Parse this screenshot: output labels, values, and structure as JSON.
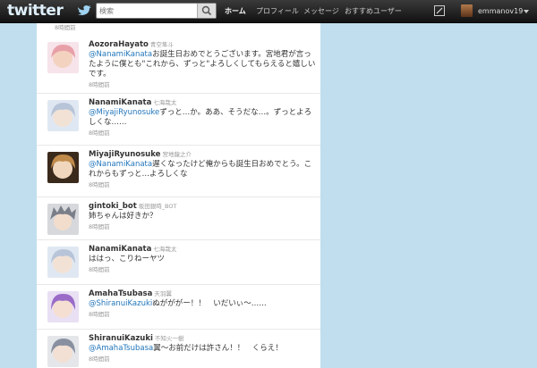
{
  "header": {
    "logo": "twitter",
    "search_placeholder": "検索",
    "nav": [
      "ホーム",
      "プロフィール",
      "メッセージ",
      "おすすめユーザー"
    ],
    "username": "emmanov19"
  },
  "timeline": {
    "top_time": "8時間前",
    "tweets": [
      {
        "screen_name": "AozoraHayato",
        "full_name": "青空隼斗",
        "mention": "@NanamiKanata",
        "text": "お誕生日おめでとうございます。宮地君が言ったように僕とも\"これから、ずっと\"よろしくしてもらえると嬉しいです。",
        "time": "8時間前",
        "avatar_color": "#e8a0a8"
      },
      {
        "screen_name": "NanamiKanata",
        "full_name": "七海哉太",
        "mention": "@MiyajiRyunosuke",
        "text": "ずっと…か。ああ、そうだな…。ずっとよろしくな……",
        "time": "8時間前",
        "avatar_color": "#b8c4d8"
      },
      {
        "screen_name": "MiyajiRyunosuke",
        "full_name": "宮地龍之介",
        "mention": "@NanamiKanata",
        "text": "遅くなったけど俺からも誕生日おめでとう。これからもずっと…よろしくな",
        "time": "8時間前",
        "avatar_color": "#c08a4a"
      },
      {
        "screen_name": "gintoki_bot",
        "full_name": "坂田銀時_BOT",
        "mention": "",
        "text": "姉ちゃんは好きか？",
        "time": "8時間前",
        "avatar_color": "#7a7e88"
      },
      {
        "screen_name": "NanamiKanata",
        "full_name": "七海哉太",
        "mention": "",
        "text": "ははっ、こりねーヤツ",
        "time": "8時間前",
        "avatar_color": "#b8c4d8"
      },
      {
        "screen_name": "AmahaTsubasa",
        "full_name": "天羽翼",
        "mention": "@ShiranuiKazuki",
        "text": "ぬがががー！！　いだいぃ～……",
        "time": "8時間前",
        "avatar_color": "#9a6cc8"
      },
      {
        "screen_name": "ShiranuiKazuki",
        "full_name": "不知火一樹",
        "mention": "@AmahaTsubasa",
        "text": "翼～お前だけは許さん！！　くらえ！",
        "time": "8時間前",
        "avatar_color": "#8890a0"
      }
    ]
  }
}
